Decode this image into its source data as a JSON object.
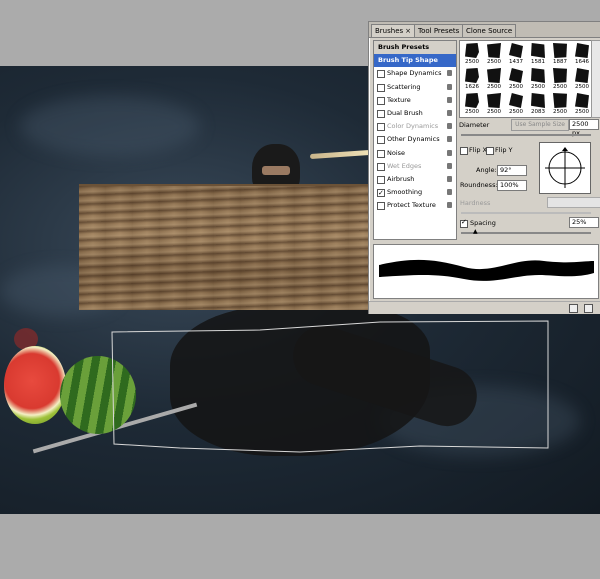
{
  "panel": {
    "tabs": [
      {
        "label": "Brushes",
        "close": "×"
      },
      {
        "label": "Tool Presets"
      },
      {
        "label": "Clone Source"
      }
    ],
    "options": [
      {
        "label": "Brush Presets",
        "kind": "header"
      },
      {
        "label": "Brush Tip Shape",
        "kind": "selected"
      },
      {
        "label": "Shape Dynamics",
        "checked": false,
        "disabled": false
      },
      {
        "label": "Scattering",
        "checked": false,
        "disabled": false
      },
      {
        "label": "Texture",
        "checked": false,
        "disabled": false
      },
      {
        "label": "Dual Brush",
        "checked": false,
        "disabled": false
      },
      {
        "label": "Color Dynamics",
        "checked": false,
        "disabled": true
      },
      {
        "label": "Other Dynamics",
        "checked": false,
        "disabled": false
      },
      {
        "label": "Noise",
        "checked": false,
        "disabled": false
      },
      {
        "label": "Wet Edges",
        "checked": false,
        "disabled": true
      },
      {
        "label": "Airbrush",
        "checked": false,
        "disabled": false
      },
      {
        "label": "Smoothing",
        "checked": true,
        "disabled": false
      },
      {
        "label": "Protect Texture",
        "checked": false,
        "disabled": false
      }
    ],
    "tips": [
      "2500",
      "2500",
      "1437",
      "1581",
      "1887",
      "1646",
      "1626",
      "2500",
      "2500",
      "2500",
      "2500",
      "2500",
      "2500",
      "2500",
      "2500",
      "2083",
      "2500",
      "2500"
    ],
    "diameter_label": "Diameter",
    "use_sample_size": "Use Sample Size",
    "diameter_value": "2500 px",
    "flip_x": "Flip X",
    "flip_y": "Flip Y",
    "angle_label": "Angle:",
    "angle_value": "92°",
    "roundness_label": "Roundness:",
    "roundness_value": "100%",
    "hardness_label": "Hardness",
    "spacing_label": "Spacing",
    "spacing_value": "25%",
    "spacing_checked": true
  },
  "colors": {
    "panel_bg": "#d4d0c8",
    "selected_row": "#3668c8",
    "canvas_gray": "#ababab",
    "doc_sky": "#1e2a36",
    "wood": "#a58763"
  }
}
